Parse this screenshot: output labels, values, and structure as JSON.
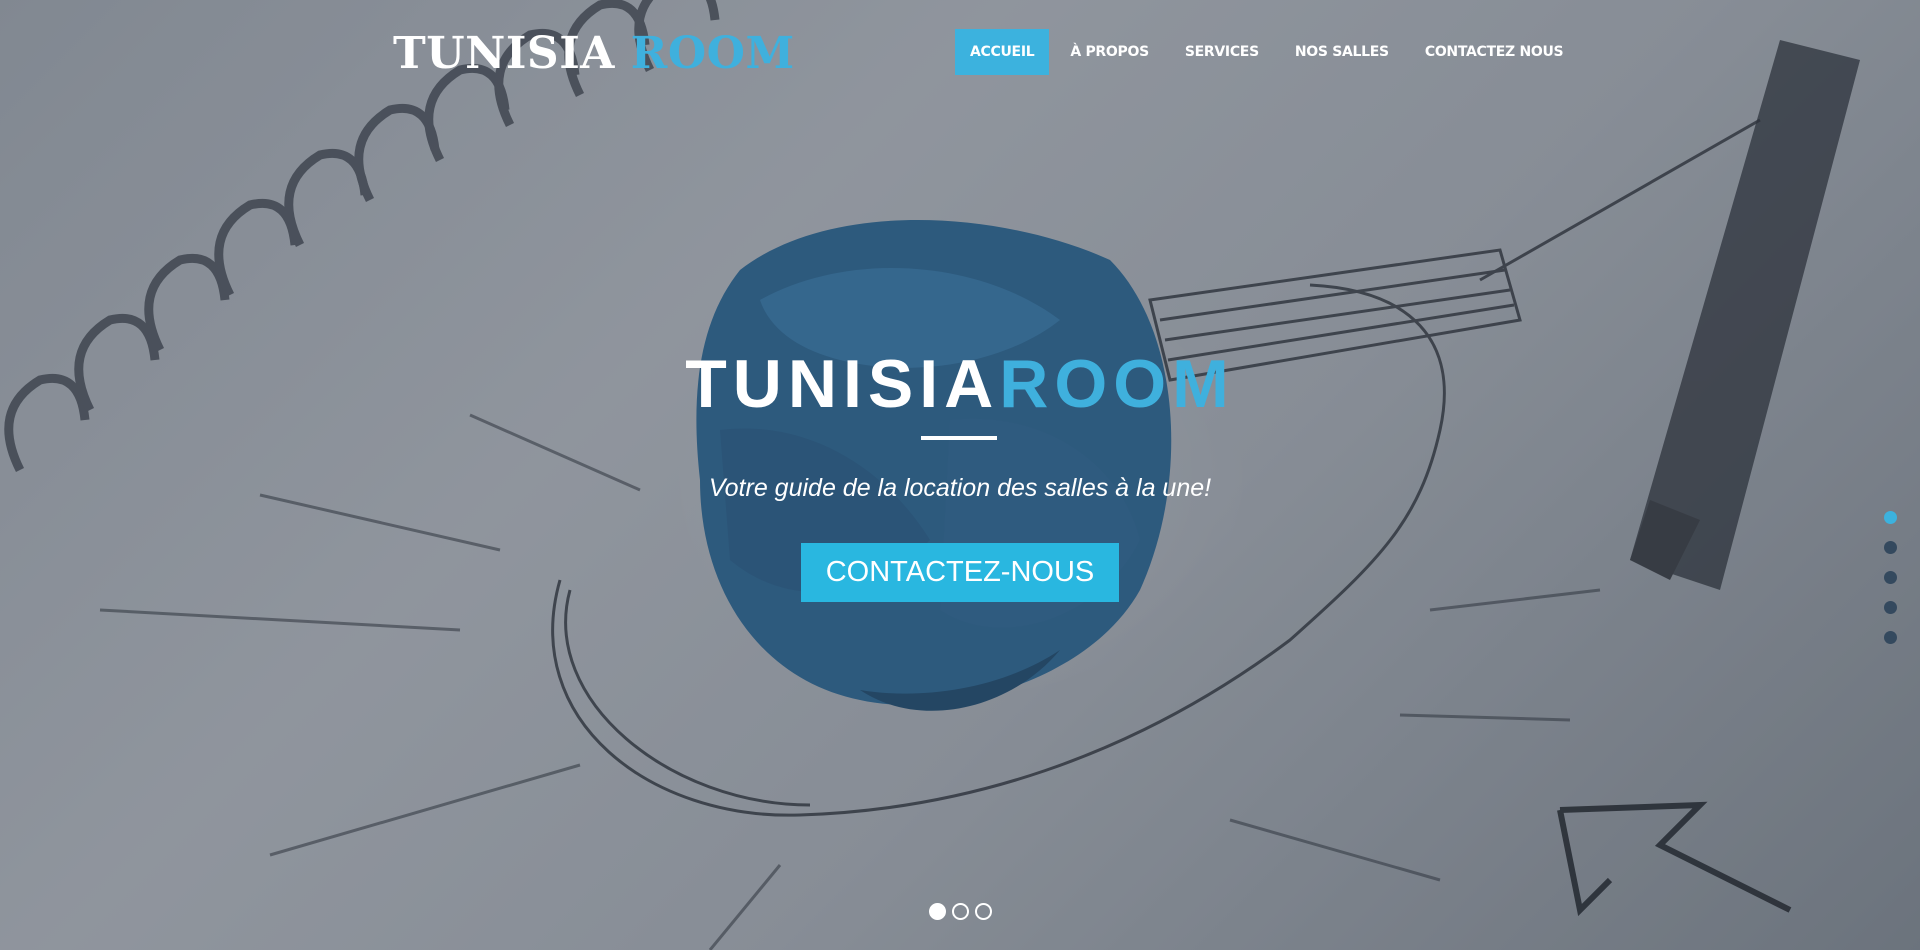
{
  "header": {
    "logo_primary": "TUNISIA",
    "logo_accent": "ROOM"
  },
  "nav": {
    "items": [
      {
        "label": "ACCUEIL",
        "active": true
      },
      {
        "label": "À PROPOS",
        "active": false
      },
      {
        "label": "SERVICES",
        "active": false
      },
      {
        "label": "NOS SALLES",
        "active": false
      },
      {
        "label": "CONTACTEZ NOUS",
        "active": false
      }
    ]
  },
  "hero": {
    "title_primary": "TUNISIA",
    "title_accent": "ROOM",
    "subtitle": "Votre guide de la location des salles à la une!",
    "cta_label": "CONTACTEZ-NOUS"
  },
  "section_nav": {
    "count": 5,
    "active_index": 0
  },
  "slider": {
    "count": 3,
    "active_index": 0
  },
  "colors": {
    "accent": "#3cb2de",
    "cta": "#29b7e0",
    "section_dot": "#34495e",
    "text": "#ffffff"
  }
}
